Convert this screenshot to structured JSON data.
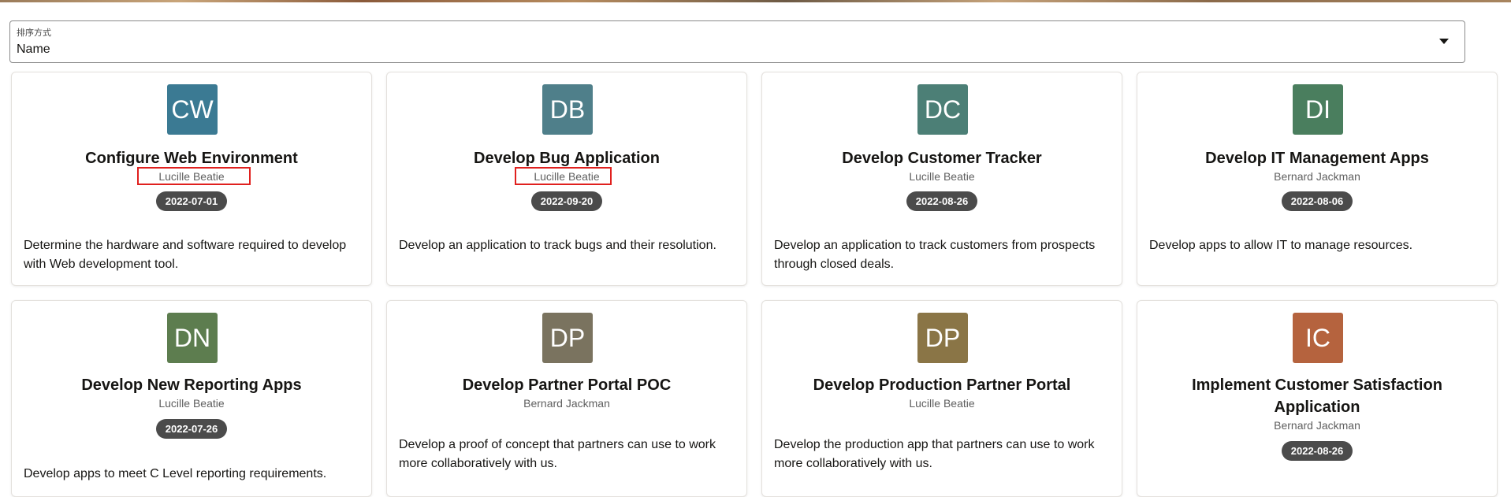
{
  "sort": {
    "label": "排序方式",
    "value": "Name",
    "caret_icon": "caret-down-icon"
  },
  "cards": [
    {
      "initials": "CW",
      "color": "#3b7a93",
      "title": "Configure Web Environment",
      "owner": "Lucille Beatie",
      "date": "2022-07-01",
      "description": "Determine the hardware and software required to develop with Web development tool.",
      "owner_highlighted": true
    },
    {
      "initials": "DB",
      "color": "#4f7f8a",
      "title": "Develop Bug Application",
      "owner": "Lucille Beatie",
      "date": "2022-09-20",
      "description": "Develop an application to track bugs and their resolution.",
      "owner_highlighted": true
    },
    {
      "initials": "DC",
      "color": "#4c7f76",
      "title": "Develop Customer Tracker",
      "owner": "Lucille Beatie",
      "date": "2022-08-26",
      "description": "Develop an application to track customers from prospects through closed deals.",
      "owner_highlighted": false
    },
    {
      "initials": "DI",
      "color": "#4a7e5e",
      "title": "Develop IT Management Apps",
      "owner": "Bernard Jackman",
      "date": "2022-08-06",
      "description": "Develop apps to allow IT to manage resources.",
      "owner_highlighted": false
    },
    {
      "initials": "DN",
      "color": "#5d7d4f",
      "title": "Develop New Reporting Apps",
      "owner": "Lucille Beatie",
      "date": "2022-07-26",
      "description": "Develop apps to meet C Level reporting requirements.",
      "owner_highlighted": false
    },
    {
      "initials": "DP",
      "color": "#7a735f",
      "title": "Develop Partner Portal POC",
      "owner": "Bernard Jackman",
      "date": "",
      "description": "Develop a proof of concept that partners can use to work more collaboratively with us.",
      "owner_highlighted": false
    },
    {
      "initials": "DP",
      "color": "#8a7546",
      "title": "Develop Production Partner Portal",
      "owner": "Lucille Beatie",
      "date": "",
      "description": "Develop the production app that partners can use to work more collaboratively with us.",
      "owner_highlighted": false
    },
    {
      "initials": "IC",
      "color": "#b5633e",
      "title": "Implement Customer Satisfaction Application",
      "owner": "Bernard Jackman",
      "date": "2022-08-26",
      "description": "",
      "owner_highlighted": false
    }
  ]
}
